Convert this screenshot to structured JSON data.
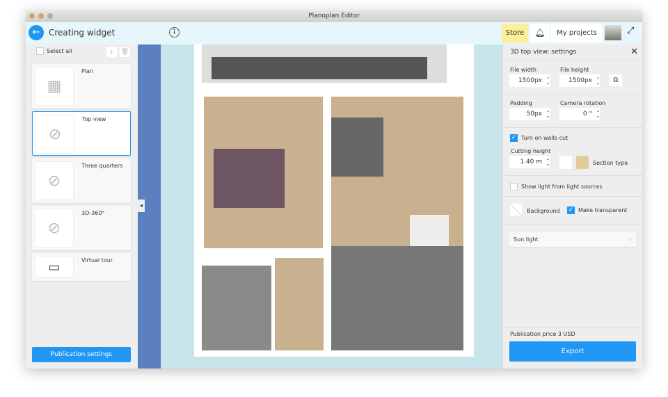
{
  "window": {
    "title": "Planoplan Editor"
  },
  "header": {
    "title": "Creating widget",
    "step": "1",
    "store": "Store",
    "my_projects": "My projects"
  },
  "left": {
    "select_all": "Select all",
    "cards": [
      {
        "label": "Plan"
      },
      {
        "label": "Top view"
      },
      {
        "label": "Three quarters"
      },
      {
        "label": "3D-360°"
      },
      {
        "label": "Virtual tour"
      }
    ],
    "publication_settings": "Publication settings"
  },
  "settings": {
    "title": "3D top view: settings",
    "file_width_label": "File width",
    "file_width": "1500px",
    "file_height_label": "File height",
    "file_height": "1500px",
    "padding_label": "Padding",
    "padding": "50px",
    "camera_rotation_label": "Camera rotation",
    "camera_rotation": "0 °",
    "walls_cut": "Turn on walls cut",
    "cutting_height_label": "Cutting height",
    "cutting_height": "1.40 m",
    "section_type": "Section type",
    "show_light": "Show light from light sources",
    "background": "Background",
    "make_transparent": "Make transparent",
    "sun_light": "Sun light",
    "price": "Publication price 3 USD",
    "export": "Export"
  },
  "colors": {
    "accent": "#2196f3",
    "store": "#fdee9a"
  }
}
